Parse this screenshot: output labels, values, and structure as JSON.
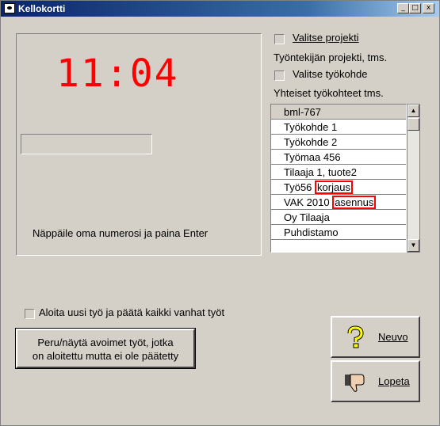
{
  "window": {
    "title": "Kellokortti",
    "controls": [
      "_",
      "□",
      "x"
    ]
  },
  "clock": {
    "time": "11:04"
  },
  "number_input": {
    "value": ""
  },
  "instruction": "Näppäile oma numerosi ja paina Enter",
  "project": {
    "checkbox_label": "Valitse projekti",
    "hint": "Työntekijän projekti, tms."
  },
  "workplace": {
    "checkbox_label": "Valitse työkohde",
    "hint": "Yhteiset työkohteet tms."
  },
  "list": {
    "items": [
      {
        "text": "bml-767"
      },
      {
        "text": "Työkohde 1"
      },
      {
        "text": "Työkohde 2"
      },
      {
        "text": "Työmaa 456"
      },
      {
        "text": "Tilaaja 1, tuote2"
      },
      {
        "prefix": "Työ56 ",
        "highlight": "korjaus"
      },
      {
        "prefix": "VAK 2010 ",
        "highlight": "asennus"
      },
      {
        "text": "Oy Tilaaja"
      },
      {
        "text": "Puhdistamo"
      }
    ],
    "highlight_color": "#ff0000"
  },
  "start_new": {
    "checkbox_label": "Aloita uusi työ ja päätä kaikki vanhat työt"
  },
  "buttons": {
    "peru_line1": "Peru/näytä avoimet työt, jotka",
    "peru_line2": "on aloitettu mutta ei ole päätetty",
    "neuvo": "Neuvo",
    "lopeta": "Lopeta"
  },
  "icons": {
    "neuvo": "question-mark-icon",
    "lopeta": "thumbs-down-icon"
  },
  "colors": {
    "clock": "#ff0000",
    "titlebar": "#0a246a",
    "window_bg": "#d4d0c8"
  }
}
